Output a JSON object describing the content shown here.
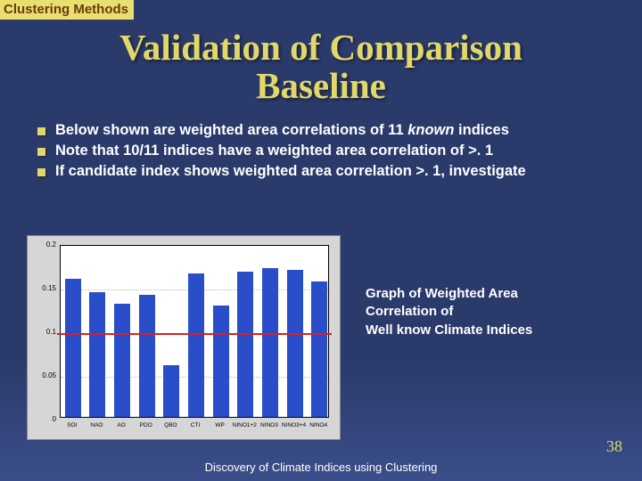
{
  "section_header": "Clustering Methods",
  "title_line1": "Validation of Comparison",
  "title_line2": "Baseline",
  "bullets": [
    {
      "pre": "Below shown are weighted area correlations of 11 ",
      "italic": "known",
      "post": " indices"
    },
    {
      "pre": "Note that 10/11 indices have a weighted area correlation of >. 1",
      "italic": "",
      "post": ""
    },
    {
      "pre": "If candidate index shows weighted area correlation >. 1, investigate",
      "italic": "",
      "post": ""
    }
  ],
  "caption_line1": "Graph of Weighted Area",
  "caption_line2": "Correlation of",
  "caption_line3": "Well know Climate Indices",
  "footer": "Discovery of Climate Indices using Clustering",
  "page_number": "38",
  "chart_data": {
    "type": "bar",
    "title": "",
    "xlabel": "",
    "ylabel": "",
    "ylim": [
      0,
      0.2
    ],
    "yticks": [
      0,
      0.05,
      0.1,
      0.15,
      0.2
    ],
    "threshold": 0.1,
    "categories": [
      "SOI",
      "NAO",
      "AO",
      "PDO",
      "QBO",
      "CTI",
      "WP",
      "NINO1+2",
      "NINO3",
      "NINO3+4",
      "NINO4"
    ],
    "values": [
      0.158,
      0.143,
      0.13,
      0.14,
      0.059,
      0.164,
      0.128,
      0.166,
      0.17,
      0.168,
      0.155
    ]
  },
  "colors": {
    "accent": "#e2d86a",
    "bar": "#2a4dc9",
    "threshold_line": "#d52222",
    "background_top": "#2a3a6a"
  }
}
